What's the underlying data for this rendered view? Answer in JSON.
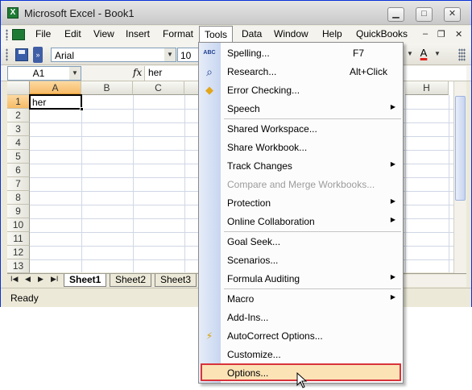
{
  "window": {
    "title": "Microsoft Excel - Book1",
    "app_icon": "X"
  },
  "caption_buttons": {
    "minimize": "▁",
    "maximize": "□",
    "close": "✕"
  },
  "menubar": {
    "items": [
      "File",
      "Edit",
      "View",
      "Insert",
      "Format",
      "Tools",
      "Data",
      "Window",
      "Help",
      "QuickBooks"
    ],
    "active": "Tools",
    "mdi_minimize": "–",
    "mdi_restore": "❐",
    "mdi_close": "✕"
  },
  "toolbar": {
    "font_name": "Arial",
    "font_size": "10",
    "font_color_label": "A"
  },
  "formula_bar": {
    "name_box": "A1",
    "fx": "fx",
    "value": "her"
  },
  "grid": {
    "columns": [
      "A",
      "B",
      "C",
      "",
      "",
      "",
      "",
      "H"
    ],
    "rows": [
      "1",
      "2",
      "3",
      "4",
      "5",
      "6",
      "7",
      "8",
      "9",
      "10",
      "11",
      "12",
      "13"
    ],
    "active_cell_value": "her",
    "selected_column": "A",
    "selected_row": "1"
  },
  "sheet_tabs": {
    "tabs": [
      "Sheet1",
      "Sheet2",
      "Sheet3"
    ],
    "active": "Sheet1",
    "nav": [
      "I◀",
      "◀",
      "▶",
      "▶I"
    ]
  },
  "status_bar": {
    "text": "Ready"
  },
  "tools_menu": {
    "items": [
      {
        "label": "Spelling...",
        "shortcut": "F7",
        "icon": "spelling-abc-icon",
        "glyph": "ABC"
      },
      {
        "label": "Research...",
        "shortcut": "Alt+Click",
        "icon": "research-icon",
        "glyph": "⌕"
      },
      {
        "label": "Error Checking...",
        "icon": "error-checking-icon",
        "glyph": "◆"
      },
      {
        "label": "Speech",
        "submenu": true
      },
      {
        "label": "Shared Workspace..."
      },
      {
        "label": "Share Workbook..."
      },
      {
        "label": "Track Changes",
        "submenu": true
      },
      {
        "label": "Compare and Merge Workbooks...",
        "disabled": true
      },
      {
        "label": "Protection",
        "submenu": true
      },
      {
        "label": "Online Collaboration",
        "submenu": true
      },
      {
        "label": "Goal Seek..."
      },
      {
        "label": "Scenarios..."
      },
      {
        "label": "Formula Auditing",
        "submenu": true
      },
      {
        "label": "Macro",
        "submenu": true
      },
      {
        "label": "Add-Ins..."
      },
      {
        "label": "AutoCorrect Options...",
        "icon": "autocorrect-icon",
        "glyph": "⚡"
      },
      {
        "label": "Customize..."
      },
      {
        "label": "Options...",
        "highlighted": true
      }
    ],
    "submenu_arrow": "▶"
  },
  "colors": {
    "menu_highlight": "#fbe3b6",
    "highlight_border": "#d8333c",
    "selected_header": "#f7bb67"
  }
}
